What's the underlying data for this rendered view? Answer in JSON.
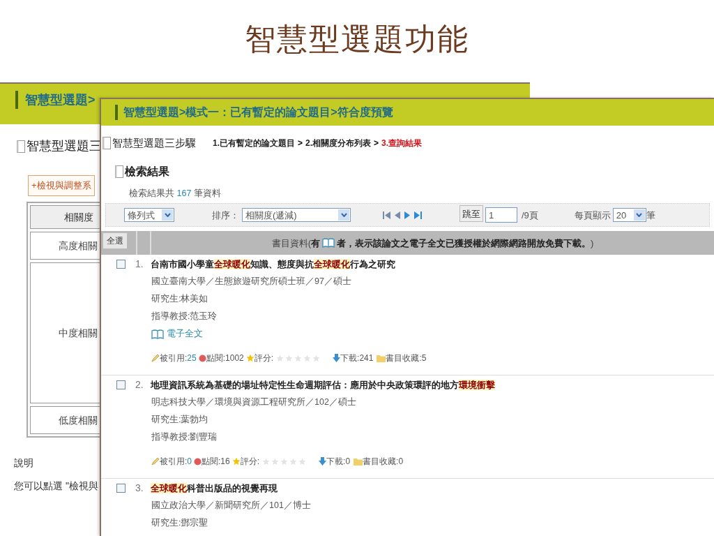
{
  "slide_title": "智慧型選題功能",
  "back_window": {
    "header": "智慧型選題>",
    "section_title": "智慧型選題三",
    "adjust_button": "+檢視與調整系",
    "table": {
      "column": "相關度",
      "rows": [
        "高度相關",
        "中度相關",
        "低度相關"
      ]
    },
    "note_heading": "說明",
    "note_text": "您可以點選 \"檢視與"
  },
  "front_window": {
    "header": "智慧型選題>模式一：已有暫定的論文題目>符合度預覽",
    "steps": {
      "title": "智慧型選題三步驟",
      "items": [
        {
          "label": "1.已有暫定的論文題目",
          "selected": false
        },
        {
          "label": "2.相關度分布列表",
          "selected": false
        },
        {
          "label": "3.查詢結果",
          "selected": true
        }
      ],
      "separator": ">"
    },
    "results_title": "檢索結果",
    "count": {
      "prefix": "檢索結果共",
      "value": "167",
      "suffix": "筆資料"
    },
    "toolbar": {
      "view": "條列式",
      "sort_label": "排序：",
      "sort": "相關度(遞減)",
      "jump_button": "跳至",
      "page": "1",
      "pages": "/9頁",
      "per_page_label": "每頁顯示",
      "per_page": "20",
      "per_page_suffix": "筆"
    },
    "table_header": {
      "select_all": "全選",
      "note_prefix": "書目資料(",
      "note_bold": "有",
      "note_rest": "者，表示該論文之電子全文已獲授權於網際網路開放免費下載。",
      "note_end": ")"
    },
    "items": [
      {
        "number": "1.",
        "checked": false,
        "title": [
          {
            "text": "台南市國小學童",
            "highlight": false
          },
          {
            "text": "全球暖化",
            "highlight": true
          },
          {
            "text": "知識、態度與抗",
            "highlight": false
          },
          {
            "text": "全球暖化",
            "highlight": true
          },
          {
            "text": "行為之研究",
            "highlight": false
          }
        ],
        "source": "國立臺南大學／生態旅遊研究所碩士班／97／碩士",
        "student": "研究生:林美如",
        "advisor": "指導教授:范玉玲",
        "fulltext": "電子全文",
        "stats": {
          "cited_label": "被引用:",
          "cited": "25",
          "views": "點閱:1002",
          "rating": "評分:",
          "stars": 0,
          "downloads": "下載:241",
          "bookmarks": "書目收藏:5"
        }
      },
      {
        "number": "2.",
        "checked": false,
        "title": [
          {
            "text": "地理資訊系統為基礎的場址特定性生命週期評估：應用於中央政策環評的地方",
            "highlight": false
          },
          {
            "text": "環境衝擊",
            "highlight": true
          }
        ],
        "source": "明志科技大學／環境與資源工程研究所／102／碩士",
        "student": "研究生:葉勃均",
        "advisor": "指導教授:劉豐瑞",
        "stats": {
          "cited_label": "被引用:",
          "cited": "0",
          "views": "點閱:16",
          "rating": "評分:",
          "stars": 0,
          "downloads": "下載:0",
          "bookmarks": "書目收藏:0"
        }
      },
      {
        "number": "3.",
        "checked": false,
        "title": [
          {
            "text": "全球暖化",
            "highlight": true
          },
          {
            "text": "科普出版品的視覺再現",
            "highlight": false
          }
        ],
        "source": "國立政治大學／新聞研究所／101／博士",
        "student": "研究生:鄧宗聖"
      }
    ]
  }
}
